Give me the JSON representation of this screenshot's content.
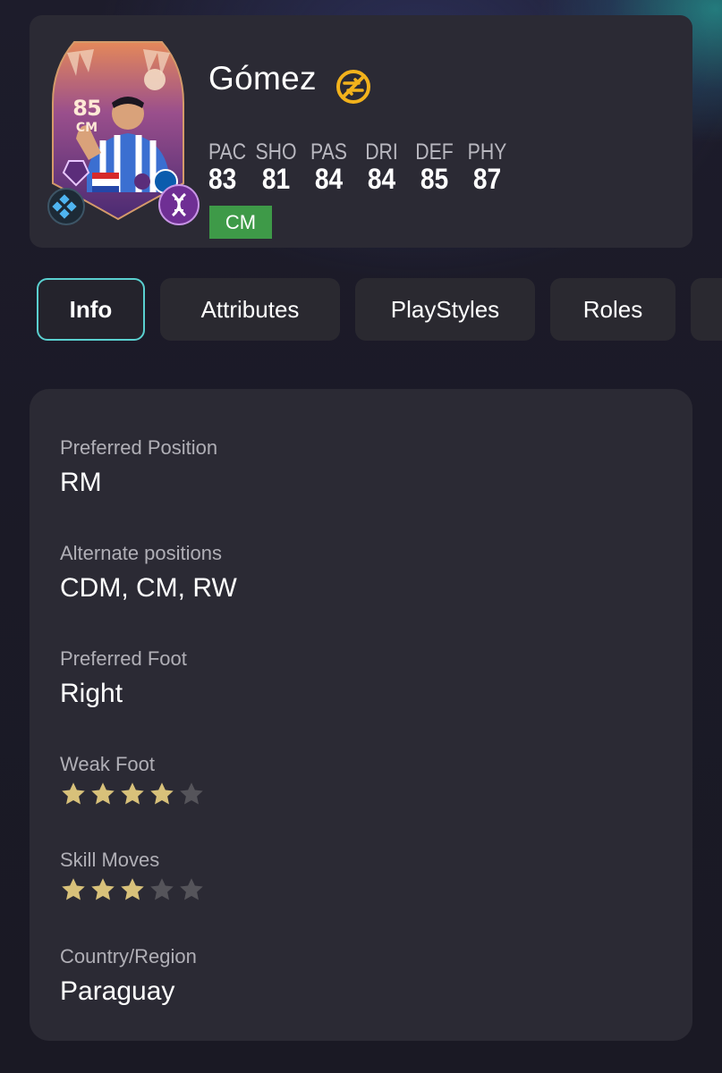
{
  "player": {
    "name": "Gómez",
    "card_rating": "85",
    "card_position": "CM",
    "stats": [
      {
        "label": "PAC",
        "value": "83"
      },
      {
        "label": "SHO",
        "value": "81"
      },
      {
        "label": "PAS",
        "value": "84"
      },
      {
        "label": "DRI",
        "value": "84"
      },
      {
        "label": "DEF",
        "value": "85"
      },
      {
        "label": "PHY",
        "value": "87"
      }
    ],
    "position_badge": "CM"
  },
  "tabs": [
    {
      "label": "Info",
      "active": true
    },
    {
      "label": "Attributes",
      "active": false
    },
    {
      "label": "PlayStyles",
      "active": false
    },
    {
      "label": "Roles",
      "active": false
    }
  ],
  "info": {
    "preferred_position": {
      "label": "Preferred Position",
      "value": "RM"
    },
    "alternate_positions": {
      "label": "Alternate positions",
      "value": "CDM, CM, RW"
    },
    "preferred_foot": {
      "label": "Preferred Foot",
      "value": "Right"
    },
    "weak_foot": {
      "label": "Weak Foot",
      "stars": 4,
      "max": 5
    },
    "skill_moves": {
      "label": "Skill Moves",
      "stars": 3,
      "max": 5
    },
    "country": {
      "label": "Country/Region",
      "value": "Paraguay"
    }
  },
  "colors": {
    "accent": "#5ad0d0",
    "badge_green": "#3e9a48",
    "star_filled": "#d8c17a",
    "star_empty": "#55545a",
    "untradeable": "#f2b21c"
  }
}
